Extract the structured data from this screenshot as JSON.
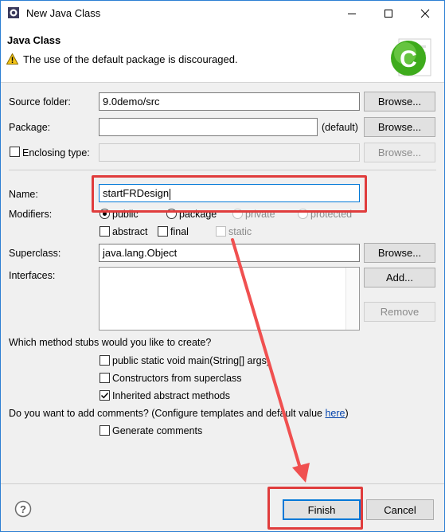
{
  "window": {
    "title": "New Java Class",
    "minimize_icon": "minimize-icon",
    "maximize_icon": "maximize-icon",
    "close_icon": "close-icon"
  },
  "banner": {
    "title": "Java Class",
    "message": "The use of the default package is discouraged.",
    "warning_icon": "warning-icon",
    "logo_icon": "new-class-logo-icon",
    "logo_letter": "C"
  },
  "form": {
    "source_folder": {
      "label": "Source folder:",
      "value": "9.0demo/src",
      "browse": "Browse..."
    },
    "package": {
      "label": "Package:",
      "value": "",
      "suffix": "(default)",
      "browse": "Browse..."
    },
    "enclosing_type": {
      "label": "Enclosing type:",
      "value": "",
      "checked": false,
      "browse": "Browse..."
    },
    "name": {
      "label": "Name:",
      "value": "startFRDesign"
    },
    "modifiers": {
      "label": "Modifiers:",
      "access": [
        {
          "label": "public",
          "selected": true,
          "enabled": true
        },
        {
          "label": "package",
          "selected": false,
          "enabled": true
        },
        {
          "label": "private",
          "selected": false,
          "enabled": false
        },
        {
          "label": "protected",
          "selected": false,
          "enabled": false
        }
      ],
      "flags": [
        {
          "label": "abstract",
          "checked": false,
          "enabled": true
        },
        {
          "label": "final",
          "checked": false,
          "enabled": true
        },
        {
          "label": "static",
          "checked": false,
          "enabled": false
        }
      ]
    },
    "superclass": {
      "label": "Superclass:",
      "value": "java.lang.Object",
      "browse": "Browse..."
    },
    "interfaces": {
      "label": "Interfaces:",
      "add": "Add...",
      "remove": "Remove"
    }
  },
  "stubs": {
    "question": "Which method stubs would you like to create?",
    "options": [
      {
        "label": "public static void main(String[] args)",
        "checked": false
      },
      {
        "label": "Constructors from superclass",
        "checked": false
      },
      {
        "label": "Inherited abstract methods",
        "checked": true
      }
    ]
  },
  "comments": {
    "question": "Do you want to add comments? (Configure templates and default value ",
    "link": "here",
    "question_end": ")",
    "option": {
      "label": "Generate comments",
      "checked": false
    }
  },
  "footer": {
    "help_icon": "help-icon",
    "help_glyph": "?",
    "finish": "Finish",
    "cancel": "Cancel"
  },
  "annotations": {
    "highlight_color": "#e03c3c",
    "arrow_color": "#f05050"
  }
}
